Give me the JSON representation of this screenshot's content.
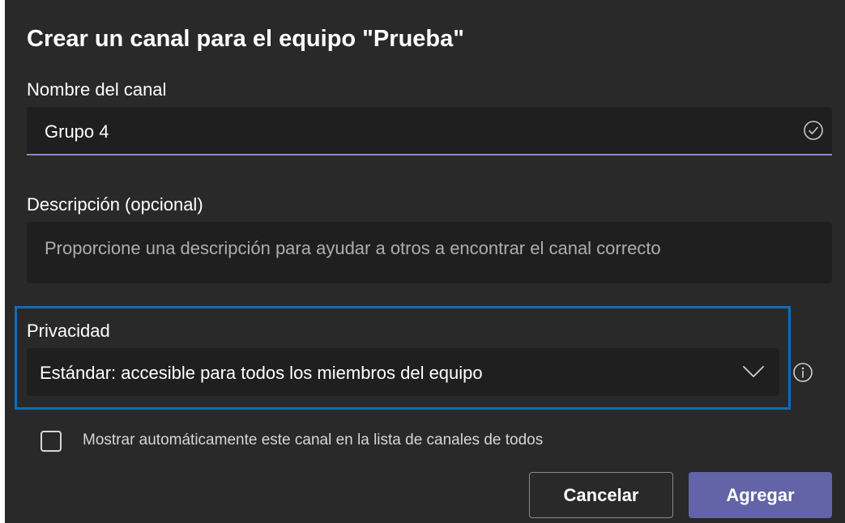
{
  "dialog": {
    "title": "Crear un canal para el equipo \"Prueba\""
  },
  "channel_name": {
    "label": "Nombre del canal",
    "value": "Grupo 4",
    "status_icon": "check-circle-icon"
  },
  "description": {
    "label": "Descripción (opcional)",
    "placeholder": "Proporcione una descripción para ayudar a otros a encontrar el canal correcto",
    "value": ""
  },
  "privacy": {
    "label": "Privacidad",
    "selected": "Estándar: accesible para todos los miembros del equipo",
    "dropdown_icon": "chevron-down-icon",
    "info_icon": "info-icon"
  },
  "auto_show": {
    "label": "Mostrar automáticamente este canal en la lista de canales de todos",
    "checked": false
  },
  "buttons": {
    "cancel": "Cancelar",
    "add": "Agregar"
  },
  "colors": {
    "background": "#292929",
    "input_background": "#1f1f1f",
    "accent": "#6264a7",
    "focus_ring": "#0f6cbd",
    "input_underline": "#8b8cc7"
  }
}
